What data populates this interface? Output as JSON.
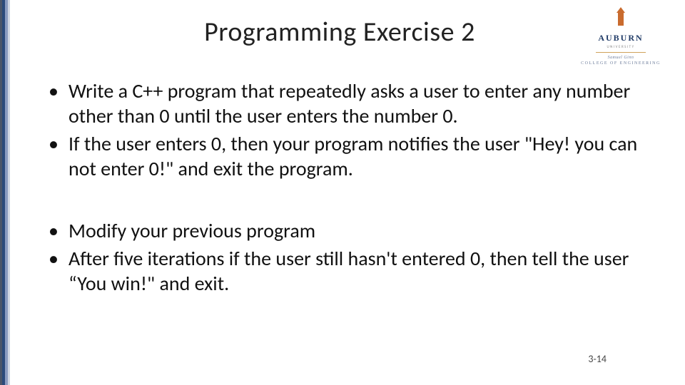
{
  "title": "Programming Exercise 2",
  "logo": {
    "word": "AUBURN",
    "sub1": "UNIVERSITY",
    "sub2": "Samuel Ginn",
    "sub3": "COLLEGE OF ENGINEERING"
  },
  "bullets": {
    "b1": "Write a C++ program that repeatedly asks a user to enter any number other than 0 until the user enters the number 0.",
    "b2": "If the user enters 0, then your program notifies the user \"Hey! you can not enter 0!\" and exit the program.",
    "b3": "Modify your previous program",
    "b4": "After five iterations if the user still hasn't entered 0, then tell the user “You win!\" and exit."
  },
  "page_number": "3-14"
}
